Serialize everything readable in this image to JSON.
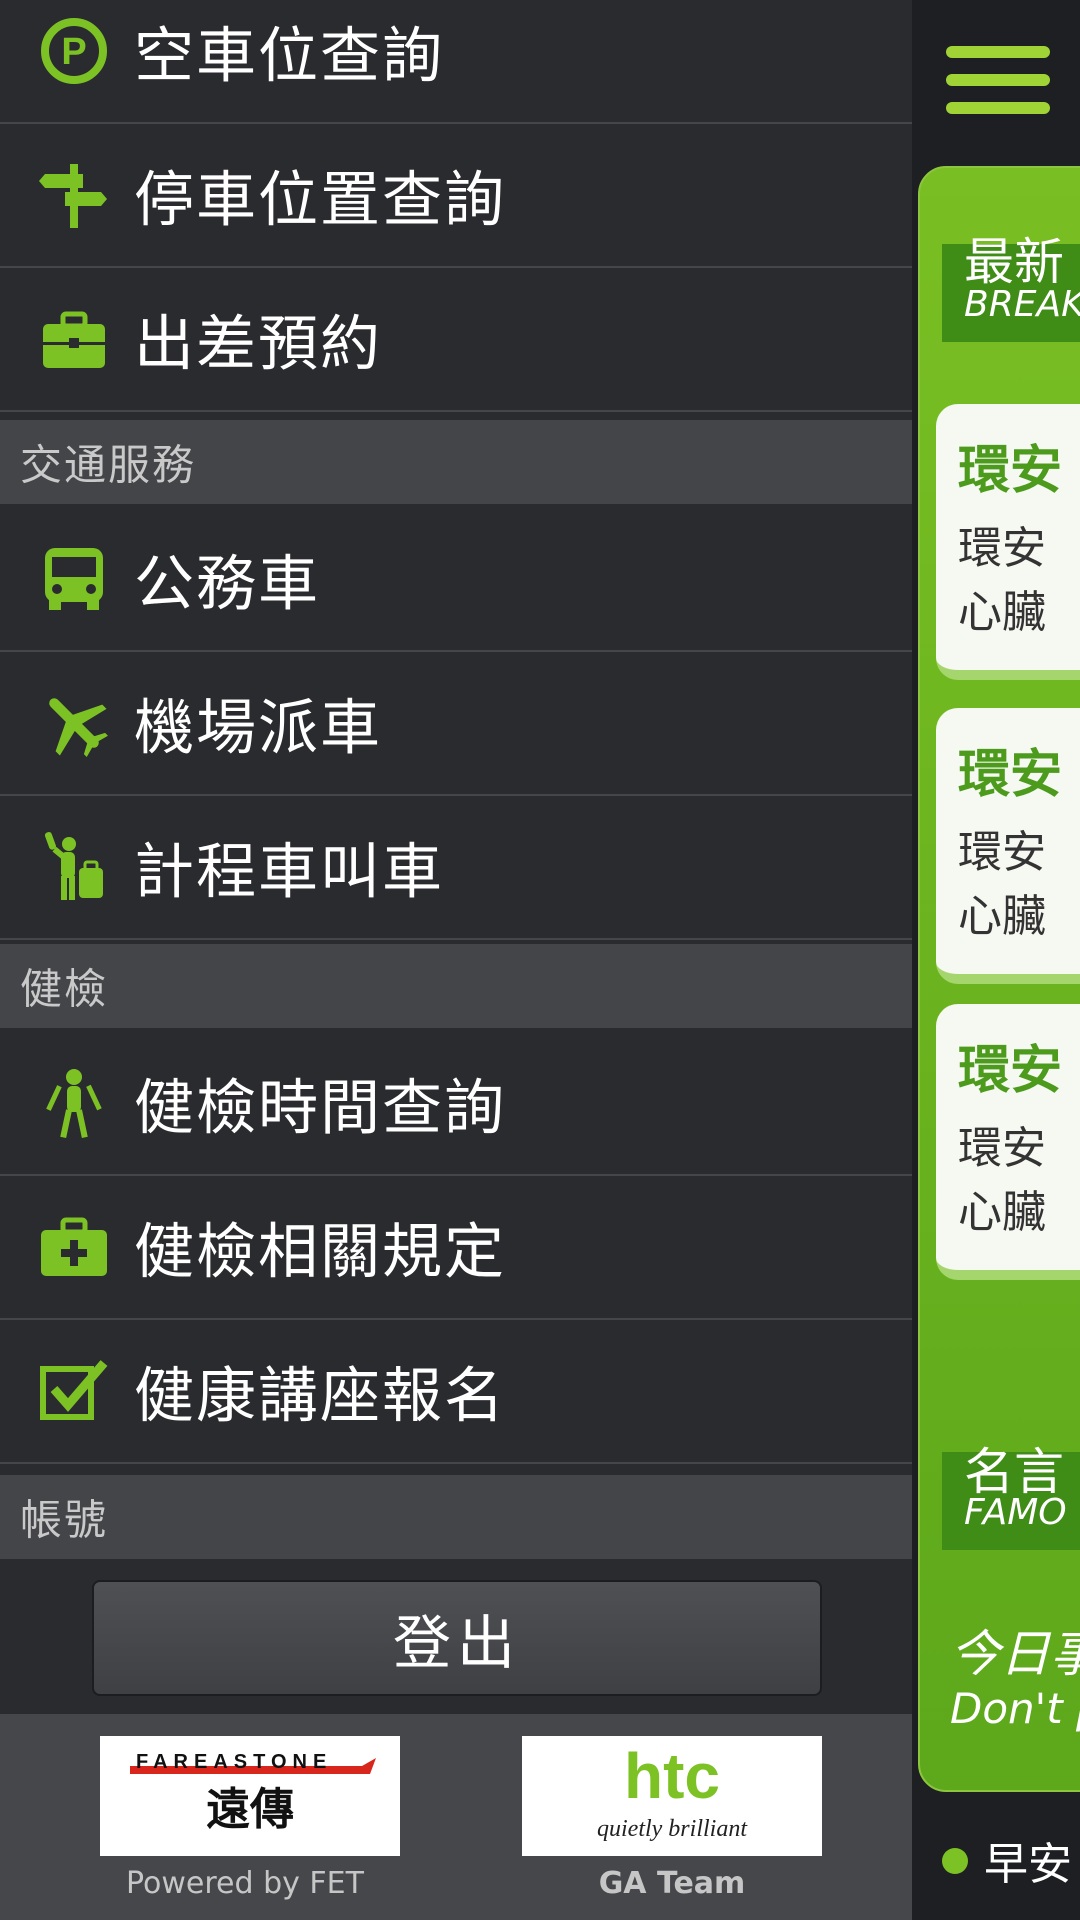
{
  "drawer": {
    "top_items": [
      {
        "icon": "parking-icon",
        "label": "空車位查詢"
      },
      {
        "icon": "signpost-icon",
        "label": "停車位置查詢"
      },
      {
        "icon": "briefcase-icon",
        "label": "出差預約"
      }
    ],
    "section_transport": {
      "title": "交通服務"
    },
    "transport_items": [
      {
        "icon": "bus-icon",
        "label": "公務車"
      },
      {
        "icon": "airplane-icon",
        "label": "機場派車"
      },
      {
        "icon": "taxi-hail-icon",
        "label": "計程車叫車"
      }
    ],
    "section_health": {
      "title": "健檢"
    },
    "health_items": [
      {
        "icon": "person-icon",
        "label": "健檢時間查詢"
      },
      {
        "icon": "medical-kit-icon",
        "label": "健檢相關規定"
      },
      {
        "icon": "checkbox-icon",
        "label": "健康講座報名"
      }
    ],
    "section_account": {
      "title": "帳號"
    },
    "logout_label": "登出",
    "footer": {
      "fet_logo_top": "FAREASTONE",
      "fet_logo_bottom": "遠傳",
      "fet_caption": "Powered by FET",
      "htc_logo_top": "htc",
      "htc_logo_bottom": "quietly brilliant",
      "htc_caption": "GA Team"
    }
  },
  "content": {
    "breaking": {
      "zh": "最新",
      "en": "BREAK"
    },
    "news": [
      {
        "title": "環安",
        "line1": "環安",
        "line2": "心臟"
      },
      {
        "title": "環安",
        "line1": "環安",
        "line2": "心臟"
      },
      {
        "title": "環安",
        "line1": "環安",
        "line2": "心臟"
      }
    ],
    "famous": {
      "zh": "名言",
      "en": "FAMO"
    },
    "quote": {
      "zh": "今日事",
      "en": "Don't p"
    },
    "status_text": "早安"
  },
  "colors": {
    "accent": "#7dc225",
    "drawer_bg": "#2a2b2f",
    "section_bg": "#434549"
  }
}
